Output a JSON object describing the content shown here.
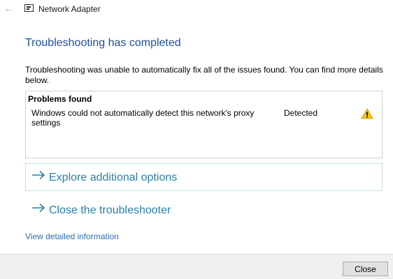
{
  "window": {
    "title": "Network Adapter"
  },
  "content": {
    "heading": "Troubleshooting has completed",
    "description": "Troubleshooting was unable to automatically fix all of the issues found. You can find more details below."
  },
  "problems": {
    "header": "Problems found",
    "items": [
      {
        "text": "Windows could not automatically detect this network's proxy settings",
        "status": "Detected",
        "icon": "warning-icon"
      }
    ]
  },
  "options": {
    "explore": "Explore additional options",
    "close": "Close the troubleshooter"
  },
  "links": {
    "details": "View detailed information"
  },
  "footer": {
    "close_label": "Close"
  },
  "colors": {
    "heading": "#1f4e9a",
    "option_text": "#2a7fa8",
    "link": "#2a6fb2",
    "warning": "#f5c518"
  }
}
